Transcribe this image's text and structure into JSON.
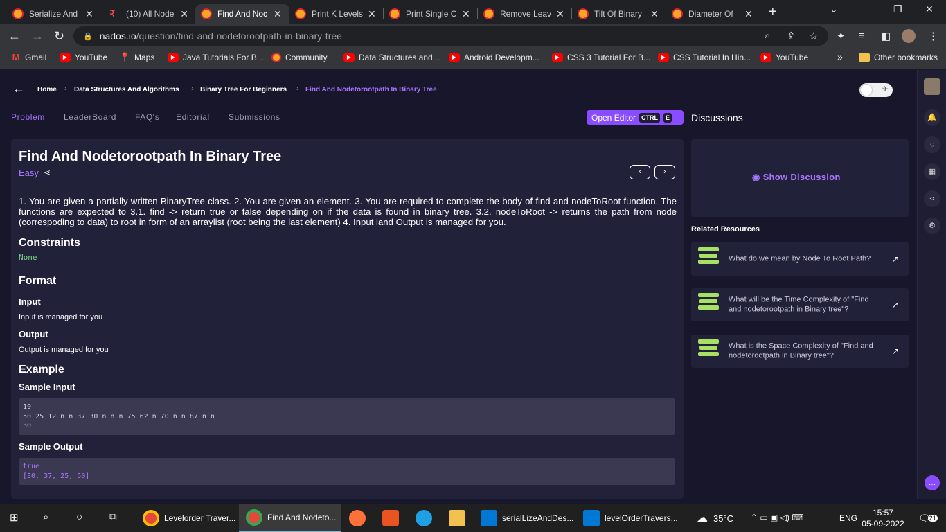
{
  "browser": {
    "tabs": [
      {
        "label": "Serialize And",
        "icon": "nados-icon"
      },
      {
        "label": "(10) All Node",
        "icon": "youtube-icon"
      },
      {
        "label": "Find And Noc",
        "icon": "nados-icon"
      },
      {
        "label": "Print K Levels",
        "icon": "nados-icon"
      },
      {
        "label": "Print Single C",
        "icon": "nados-icon"
      },
      {
        "label": "Remove Leav",
        "icon": "nados-icon"
      },
      {
        "label": "Tilt Of Binary",
        "icon": "nados-icon"
      },
      {
        "label": "Diameter Of",
        "icon": "nados-icon"
      }
    ],
    "url_host": "nados.io",
    "url_path": "/question/find-and-nodetorootpath-in-binary-tree",
    "bookmarks": [
      {
        "label": "Gmail",
        "icon": "gmail-icon"
      },
      {
        "label": "YouTube",
        "icon": "youtube-icon"
      },
      {
        "label": "Maps",
        "icon": "maps-icon"
      },
      {
        "label": "Java Tutorials For B...",
        "icon": "youtube-icon"
      },
      {
        "label": "Community",
        "icon": "nados-icon"
      },
      {
        "label": "Data Structures and...",
        "icon": "youtube-icon"
      },
      {
        "label": "Android Developm...",
        "icon": "youtube-icon"
      },
      {
        "label": "CSS 3 Tutorial For B...",
        "icon": "youtube-icon"
      },
      {
        "label": "CSS Tutorial In Hin...",
        "icon": "youtube-icon"
      },
      {
        "label": "YouTube",
        "icon": "youtube-icon"
      }
    ],
    "other_bookmarks": "Other bookmarks",
    "more": "»"
  },
  "breadcrumb": [
    "Home",
    "Data Structures And Algorithms",
    "Binary Tree For Beginners",
    "Find And Nodetorootpath In Binary Tree"
  ],
  "problem_tabs": [
    "Problem",
    "LeaderBoard",
    "FAQ's",
    "Editorial",
    "Submissions"
  ],
  "open_editor": {
    "label": "Open Editor",
    "key1": "CTRL",
    "key2": "E"
  },
  "discussions_title": "Discussions",
  "problem": {
    "title": "Find And Nodetorootpath In Binary Tree",
    "difficulty": "Easy",
    "description": "1. You are given a partially written BinaryTree class. 2. You are given an element. 3. You are required to complete the body of find and nodeToRoot function. The functions are expected to 3.1. find -> return true or false depending on if the data is found in binary tree. 3.2. nodeToRoot -> returns the path from node (correspoding to data) to root in form of an arraylist (root being the last element) 4. Input iand Output is managed for you.",
    "constraints_heading": "Constraints",
    "constraints": "None",
    "format_heading": "Format",
    "input_heading": "Input",
    "input_text": "Input is managed for you",
    "output_heading": "Output",
    "output_text": "Output is managed for you",
    "example_heading": "Example",
    "sample_input_heading": "Sample Input",
    "sample_input": [
      "19",
      "50 25 12 n n 37 30 n n n 75 62 n 70 n n 87 n n",
      "30"
    ],
    "sample_output_heading": "Sample Output",
    "sample_output": [
      "true",
      "[30, 37, 25, 50]"
    ]
  },
  "show_discussion": "Show Discussion",
  "related_heading": "Related Resources",
  "related": [
    "What do we mean by Node To Root Path?",
    "What will be the Time Complexity of \"Find and nodetorootpath in Binary tree\"?",
    "What is the Space Complexity of \"Find and nodetorootpath in Binary tree\"?"
  ],
  "taskbar": {
    "apps": [
      "Levelorder Traver...",
      "Find And Nodeto...",
      "serialLizeAndDes...",
      "levelOrderTravers..."
    ],
    "weather": "35°C",
    "lang": "ENG",
    "time": "15:57",
    "date": "05-09-2022",
    "notif_count": "21"
  },
  "colors": {
    "accent": "#a876ff",
    "button": "#8a4cff",
    "page_bg": "#17162a",
    "card_bg": "#22213a",
    "none_green": "#7bd389"
  }
}
